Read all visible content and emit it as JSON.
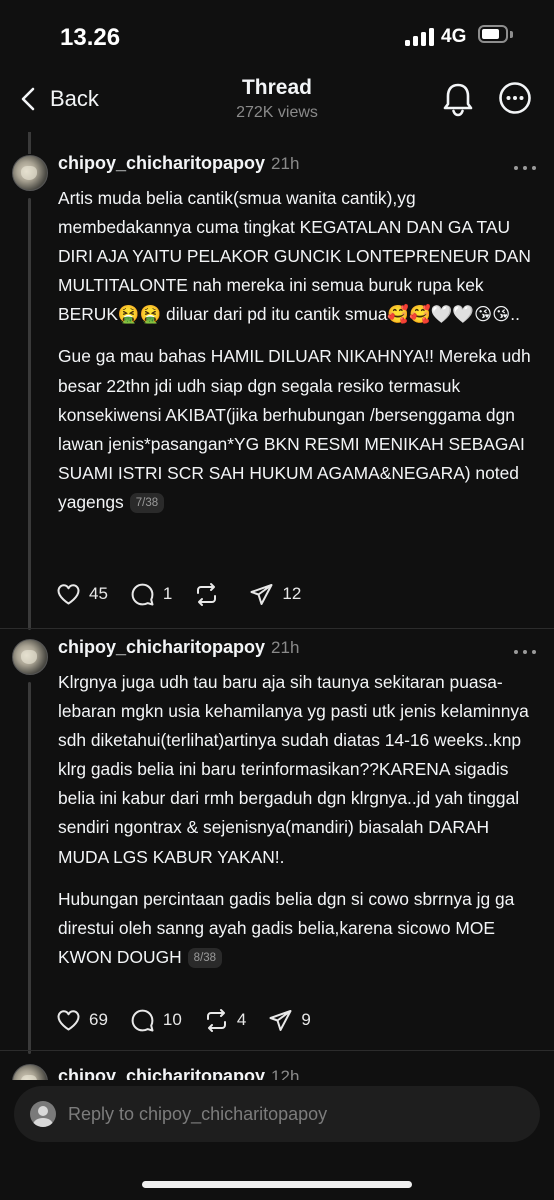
{
  "status_bar": {
    "time": "13.26",
    "network": "4G",
    "battery_level": 0.75
  },
  "nav": {
    "back_label": "Back",
    "title": "Thread",
    "subtitle": "272K views",
    "icons": [
      "chevron-left-icon",
      "bell-icon",
      "more-horizontal-icon"
    ]
  },
  "posts": [
    {
      "username": "chipoy_chicharitopapoy",
      "time": "21h",
      "paragraphs": [
        "Artis muda belia cantik(smua wanita cantik),yg membedakannya cuma tingkat KEGATALAN DAN GA TAU DIRI AJA YAITU PELAKOR GUNCIK LONTEPRENEUR DAN MULTITALONTE nah mereka ini semua buruk rupa kek BERUK🤮🤮 diluar dari pd itu cantik smua🥰🥰🤍🤍😘😘..",
        "Gue ga mau bahas HAMIL DILUAR NIKAHNYA!! Mereka udh besar 22thn jdi udh siap dgn segala resiko termasuk konsekiwensi AKIBAT(jika berhubungan /bersenggama dgn lawan jenis*pasangan*YG BKN RESMI MENIKAH SEBAGAI SUAMI ISTRI SCR SAH HUKUM AGAMA&NEGARA) noted yagengs"
      ],
      "counter": "7/38",
      "likes": "45",
      "replies": "1",
      "reposts": "",
      "shares": "12"
    },
    {
      "username": "chipoy_chicharitopapoy",
      "time": "21h",
      "paragraphs": [
        "Klrgnya juga udh tau baru aja sih taunya sekitaran puasa-lebaran mgkn usia kehamilanya yg pasti utk jenis kelaminnya sdh diketahui(terlihat)artinya sudah diatas 14-16 weeks..knp klrg gadis belia ini baru terinformasikan??KARENA sigadis belia ini kabur dari rmh bergaduh dgn klrgnya..jd yah tinggal sendiri ngontrax & sejenisnya(mandiri) biasalah DARAH MUDA LGS KABUR YAKAN!.",
        "Hubungan percintaan gadis belia dgn si cowo sbrrnya jg ga direstui oleh sanng ayah gadis belia,karena sicowo MOE KWON DOUGH"
      ],
      "counter": "8/38",
      "likes": "69",
      "replies": "10",
      "reposts": "4",
      "shares": "9"
    }
  ],
  "next_post": {
    "username": "chipoy_chicharitopapoy",
    "time": "12h"
  },
  "reply_bar": {
    "placeholder": "Reply to chipoy_chicharitopapoy"
  },
  "colors": {
    "background": "#101010",
    "text": "#f3f5f7",
    "muted": "#8a8a8a",
    "divider": "#2c2c2c",
    "reply_bar": "#1e1e1e"
  }
}
